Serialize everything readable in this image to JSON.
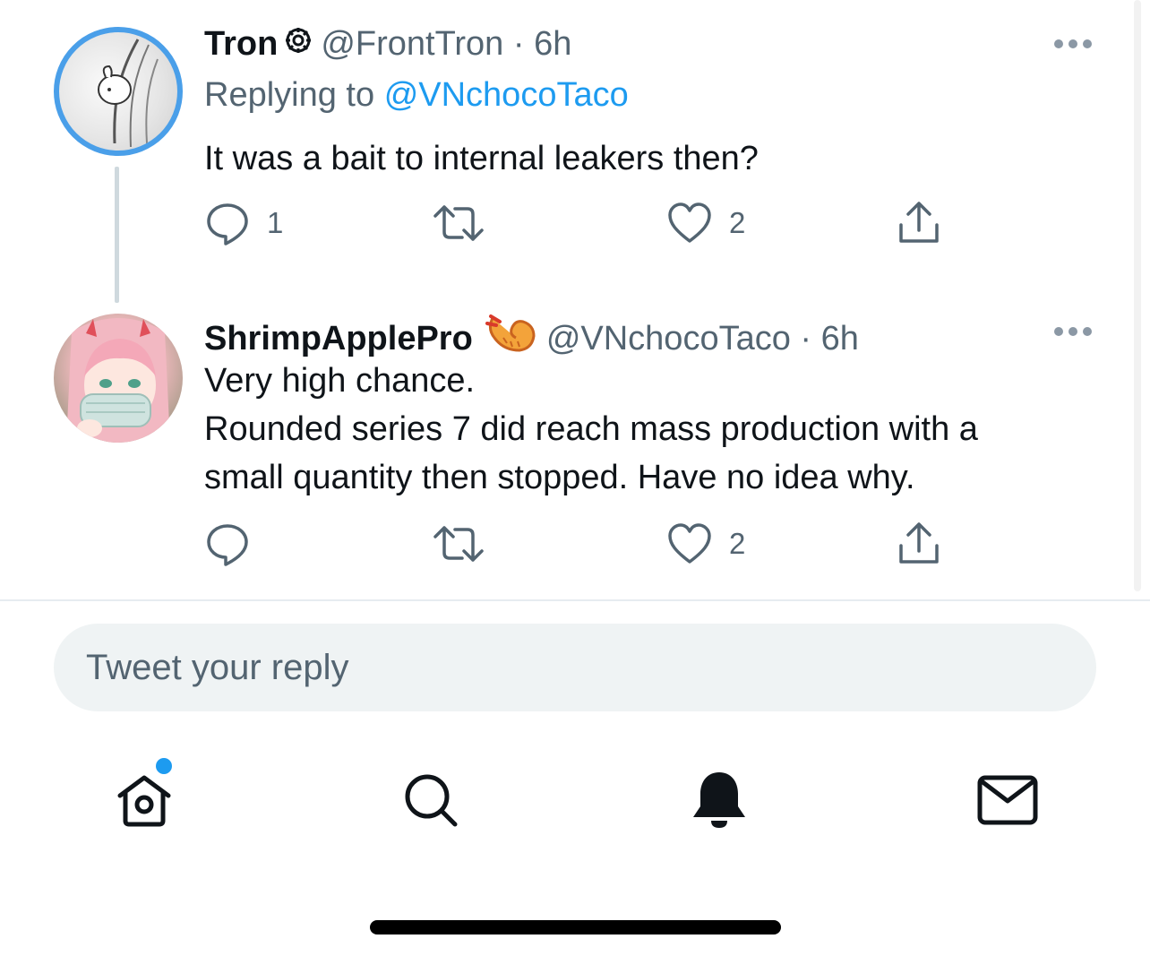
{
  "thread": [
    {
      "display_name": "Tron",
      "handle": "@FrontTron",
      "separator": "·",
      "time": "6h",
      "replying_prefix": "Replying to",
      "replying_to": "@VNchocoTaco",
      "text_lines": [
        "It was a bait to internal leakers then?"
      ],
      "reply_count": "1",
      "retweet_count": "",
      "like_count": "2"
    },
    {
      "display_name": "ShrimpApplePro",
      "handle": "@VNchocoTaco",
      "separator": "·",
      "time": "6h",
      "text_lines": [
        "Very high chance.",
        "Rounded series 7 did reach mass production with a",
        "small quantity then stopped. Have no idea why."
      ],
      "reply_count": "",
      "retweet_count": "",
      "like_count": "2"
    }
  ],
  "composer": {
    "placeholder": "Tweet your reply"
  },
  "tabbar": {
    "items": [
      "home-icon",
      "search-icon",
      "bell-icon",
      "mail-icon"
    ],
    "home_has_unread": true
  },
  "colors": {
    "accent": "#1d9bf0",
    "secondary_text": "#536471",
    "primary_text": "#0f1419"
  }
}
